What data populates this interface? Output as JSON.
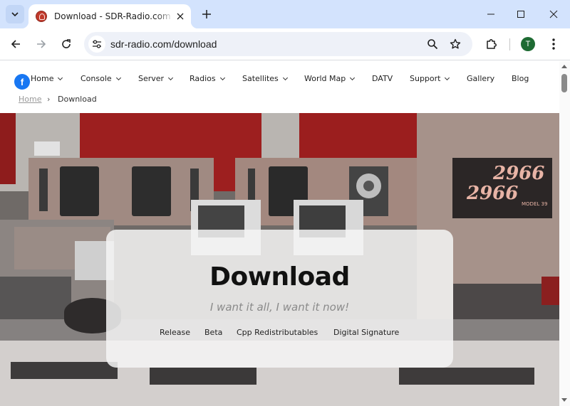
{
  "browser": {
    "tab_title": "Download - SDR-Radio.com - SDR",
    "url": "sdr-radio.com/download",
    "profile_initial": "T",
    "icons": {
      "tab_search": "chevron-down-icon",
      "tab_close": "close-icon",
      "new_tab": "plus-icon",
      "back": "arrow-left-icon",
      "forward": "arrow-right-icon",
      "reload": "reload-icon",
      "site_info": "tune-icon",
      "zoom": "magnifier-icon",
      "bookmark": "star-icon",
      "extensions": "puzzle-icon",
      "menu": "kebab-icon"
    },
    "colors": {
      "tabstrip": "#d3e3fd",
      "omnibox": "#eef1f8",
      "avatar": "#1e6b33"
    }
  },
  "site": {
    "nav": [
      {
        "label": "Home",
        "dropdown": true
      },
      {
        "label": "Console",
        "dropdown": true
      },
      {
        "label": "Server",
        "dropdown": true
      },
      {
        "label": "Radios",
        "dropdown": true
      },
      {
        "label": "Satellites",
        "dropdown": true
      },
      {
        "label": "World Map",
        "dropdown": true
      },
      {
        "label": "DATV",
        "dropdown": false
      },
      {
        "label": "Support",
        "dropdown": true
      },
      {
        "label": "Gallery",
        "dropdown": false
      },
      {
        "label": "Blog",
        "dropdown": false
      }
    ],
    "facebook_letter": "f",
    "breadcrumb": {
      "home": "Home",
      "separator": "›",
      "current": "Download"
    },
    "hero": {
      "title": "Download",
      "subtitle": "I want it all, I want it now!",
      "links": [
        "Release",
        "Beta",
        "Cpp Redistributables",
        "Digital Signature"
      ],
      "panel_logo_top": "2966",
      "panel_logo_bottom": "2966",
      "panel_logo_caption": "MODEL 39"
    }
  }
}
